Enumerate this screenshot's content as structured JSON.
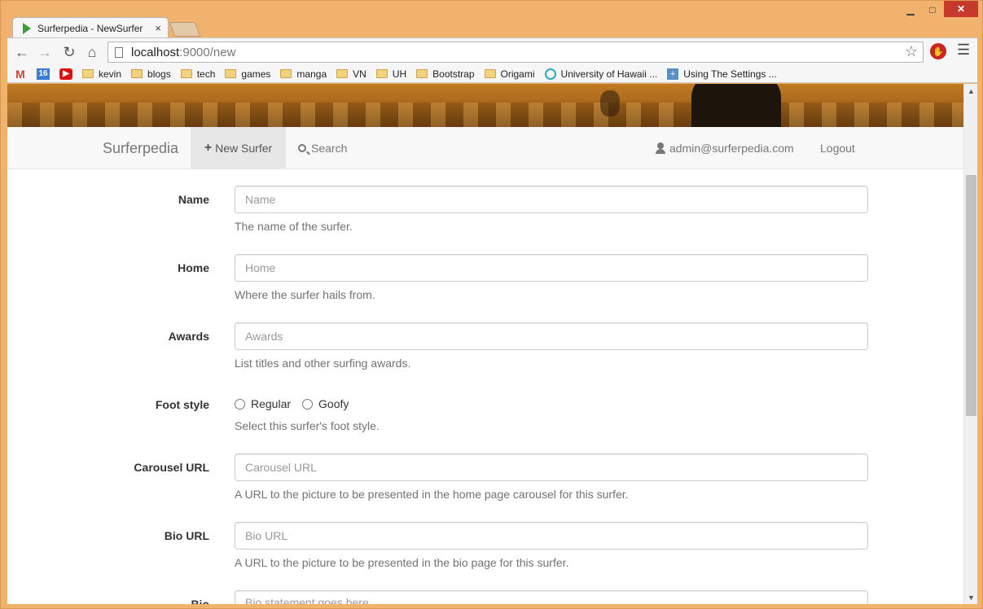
{
  "browser": {
    "tab_title": "Surferpedia - NewSurfer",
    "tab_close": "×",
    "url_host": "localhost",
    "url_path": ":9000/new",
    "window_controls": {
      "minimize": "▁",
      "maximize": "□",
      "close": "✕"
    },
    "bookmarks": [
      {
        "label": "",
        "icon": "gmail-icon"
      },
      {
        "label": "",
        "icon": "calendar-icon",
        "badge": "16"
      },
      {
        "label": "",
        "icon": "youtube-icon"
      },
      {
        "label": "kevin",
        "icon": "folder-icon"
      },
      {
        "label": "blogs",
        "icon": "folder-icon"
      },
      {
        "label": "tech",
        "icon": "folder-icon"
      },
      {
        "label": "games",
        "icon": "folder-icon"
      },
      {
        "label": "manga",
        "icon": "folder-icon"
      },
      {
        "label": "VN",
        "icon": "folder-icon"
      },
      {
        "label": "UH",
        "icon": "folder-icon"
      },
      {
        "label": "Bootstrap",
        "icon": "folder-icon"
      },
      {
        "label": "Origami",
        "icon": "folder-icon"
      },
      {
        "label": "University of Hawaii ...",
        "icon": "uh-icon"
      },
      {
        "label": "Using The Settings ...",
        "icon": "settings-doc-icon"
      }
    ]
  },
  "navbar": {
    "brand": "Surferpedia",
    "new_surfer": "New Surfer",
    "search": "Search",
    "user": "admin@surferpedia.com",
    "logout": "Logout"
  },
  "form": {
    "name": {
      "label": "Name",
      "placeholder": "Name",
      "help": "The name of the surfer."
    },
    "home": {
      "label": "Home",
      "placeholder": "Home",
      "help": "Where the surfer hails from."
    },
    "awards": {
      "label": "Awards",
      "placeholder": "Awards",
      "help": "List titles and other surfing awards."
    },
    "foot_style": {
      "label": "Foot style",
      "options": [
        "Regular",
        "Goofy"
      ],
      "help": "Select this surfer's foot style."
    },
    "carousel_url": {
      "label": "Carousel URL",
      "placeholder": "Carousel URL",
      "help": "A URL to the picture to be presented in the home page carousel for this surfer."
    },
    "bio_url": {
      "label": "Bio URL",
      "placeholder": "Bio URL",
      "help": "A URL to the picture to be presented in the bio page for this surfer."
    },
    "bio": {
      "label": "Bio",
      "placeholder": "Bio statement goes here."
    }
  },
  "colors": {
    "window_frame": "#f0b26c",
    "navbar_bg": "#f8f8f8",
    "active_nav_bg": "#e7e7e7",
    "close_button": "#c7392b"
  }
}
